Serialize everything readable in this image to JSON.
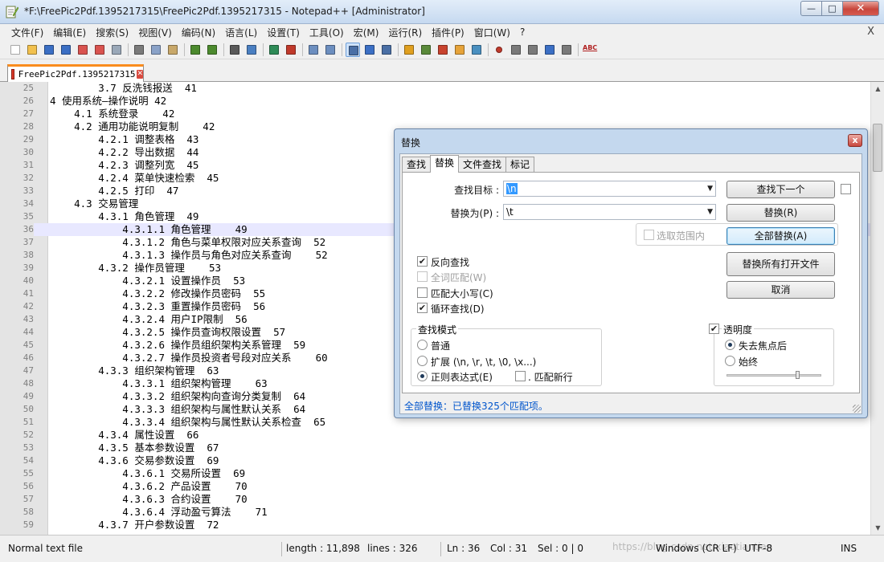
{
  "window": {
    "title": "*F:\\FreePic2Pdf.1395217315\\FreePic2Pdf.1395217315 - Notepad++ [Administrator]",
    "min_label": "—",
    "max_label": "□",
    "close_label": "✕"
  },
  "menu": {
    "items": [
      "文件(F)",
      "编辑(E)",
      "搜索(S)",
      "视图(V)",
      "编码(N)",
      "语言(L)",
      "设置(T)",
      "工具(O)",
      "宏(M)",
      "运行(R)",
      "插件(P)",
      "窗口(W)",
      "?"
    ],
    "close_label": "X"
  },
  "toolbar": {
    "icons": [
      "new-file-icon",
      "open-file-icon",
      "save-icon",
      "save-all-icon",
      "close-icon",
      "close-all-icon",
      "print-icon",
      "cut-icon",
      "copy-icon",
      "paste-icon",
      "undo-icon",
      "redo-icon",
      "find-icon",
      "replace-icon",
      "zoom-in-icon",
      "zoom-out-icon",
      "sync-vertical-icon",
      "sync-horizontal-icon",
      "word-wrap-icon",
      "show-all-chars-icon",
      "indent-guide-icon",
      "udl-icon",
      "doc-map-icon",
      "function-list-icon",
      "folder-workspace-icon",
      "monitor-icon",
      "record-macro-icon",
      "stop-macro-icon",
      "play-macro-icon",
      "run-macro-multiple-icon",
      "save-macro-icon",
      "spell-check-icon"
    ],
    "spell_label": "ABC"
  },
  "tab": {
    "name": "FreePic2Pdf.1395217315"
  },
  "editor": {
    "current_line": 36,
    "lines": [
      {
        "n": "25",
        "t": "        3.7 反洗钱报送  41"
      },
      {
        "n": "26",
        "t": "4 使用系统—操作说明 42"
      },
      {
        "n": "27",
        "t": "    4.1 系统登录    42"
      },
      {
        "n": "28",
        "t": "    4.2 通用功能说明复制    42"
      },
      {
        "n": "29",
        "t": "        4.2.1 调整表格  43"
      },
      {
        "n": "30",
        "t": "        4.2.2 导出数据  44"
      },
      {
        "n": "31",
        "t": "        4.2.3 调整列宽  45"
      },
      {
        "n": "32",
        "t": "        4.2.4 菜单快速检索  45"
      },
      {
        "n": "33",
        "t": "        4.2.5 打印  47"
      },
      {
        "n": "34",
        "t": "    4.3 交易管理"
      },
      {
        "n": "35",
        "t": "        4.3.1 角色管理  49"
      },
      {
        "n": "36",
        "t": "            4.3.1.1 角色管理    49"
      },
      {
        "n": "37",
        "t": "            4.3.1.2 角色与菜单权限对应关系查询  52"
      },
      {
        "n": "38",
        "t": "            4.3.1.3 操作员与角色对应关系查询    52"
      },
      {
        "n": "39",
        "t": "        4.3.2 操作员管理    53"
      },
      {
        "n": "40",
        "t": "            4.3.2.1 设置操作员  53"
      },
      {
        "n": "41",
        "t": "            4.3.2.2 修改操作员密码  55"
      },
      {
        "n": "42",
        "t": "            4.3.2.3 重置操作员密码  56"
      },
      {
        "n": "43",
        "t": "            4.3.2.4 用户IP限制  56"
      },
      {
        "n": "44",
        "t": "            4.3.2.5 操作员查询权限设置  57"
      },
      {
        "n": "45",
        "t": "            4.3.2.6 操作员组织架构关系管理  59"
      },
      {
        "n": "46",
        "t": "            4.3.2.7 操作员投资者号段对应关系    60"
      },
      {
        "n": "47",
        "t": "        4.3.3 组织架构管理  63"
      },
      {
        "n": "48",
        "t": "            4.3.3.1 组织架构管理    63"
      },
      {
        "n": "49",
        "t": "            4.3.3.2 组织架构向查询分类复制  64"
      },
      {
        "n": "50",
        "t": "            4.3.3.3 组织架构与属性默认关系  64"
      },
      {
        "n": "51",
        "t": "            4.3.3.4 组织架构与属性默认关系检查  65"
      },
      {
        "n": "52",
        "t": "        4.3.4 属性设置  66"
      },
      {
        "n": "53",
        "t": "        4.3.5 基本参数设置  67"
      },
      {
        "n": "54",
        "t": "        4.3.6 交易参数设置  69"
      },
      {
        "n": "55",
        "t": "            4.3.6.1 交易所设置  69"
      },
      {
        "n": "56",
        "t": "            4.3.6.2 产品设置    70"
      },
      {
        "n": "57",
        "t": "            4.3.6.3 合约设置    70"
      },
      {
        "n": "58",
        "t": "            4.3.6.4 浮动盈亏算法    71"
      },
      {
        "n": "59",
        "t": "        4.3.7 开户参数设置  72"
      }
    ]
  },
  "status": {
    "type": "Normal text file",
    "length": "length : 11,898",
    "lines": "lines : 326",
    "ln": "Ln : 36",
    "col": "Col : 31",
    "sel": "Sel : 0 | 0",
    "eol": "Windows (CR LF)",
    "encoding": "UTF-8",
    "mode": "INS",
    "watermark": "https://blog.csdn.net/xiaotiantian"
  },
  "dialog": {
    "title": "替换",
    "close_label": "x",
    "tabs": [
      "查找",
      "替换",
      "文件查找",
      "标记"
    ],
    "active_tab": 1,
    "find_label": "查找目标 :",
    "find_value": "\\n",
    "replace_label": "替换为(P) :",
    "replace_value": "\\t",
    "buttons": {
      "find_next": "查找下一个",
      "replace": "替换(R)",
      "replace_all": "全部替换(A)",
      "replace_all_open": "替换所有打开文件",
      "cancel": "取消"
    },
    "in_selection": {
      "label": "选取范围内",
      "checked": false,
      "disabled": true
    },
    "options": [
      {
        "label": "反向查找",
        "checked": true,
        "disabled": false
      },
      {
        "label": "全词匹配(W)",
        "checked": false,
        "disabled": true
      },
      {
        "label": "匹配大小写(C)",
        "checked": false,
        "disabled": false
      },
      {
        "label": "循环查找(D)",
        "checked": true,
        "disabled": false
      }
    ],
    "search_mode": {
      "title": "查找模式",
      "options": [
        "普通",
        "扩展 (\\n, \\r, \\t, \\0, \\x...)",
        "正则表达式(E)"
      ],
      "selected": 2,
      "dot_newline": ". 匹配新行"
    },
    "transparency": {
      "label": "透明度",
      "checked": true,
      "options": [
        "失去焦点后",
        "始终"
      ],
      "selected": 0,
      "level": 0.75
    },
    "status_text": "全部替换：已替换325个匹配项。",
    "status_color": "#0055cc"
  }
}
